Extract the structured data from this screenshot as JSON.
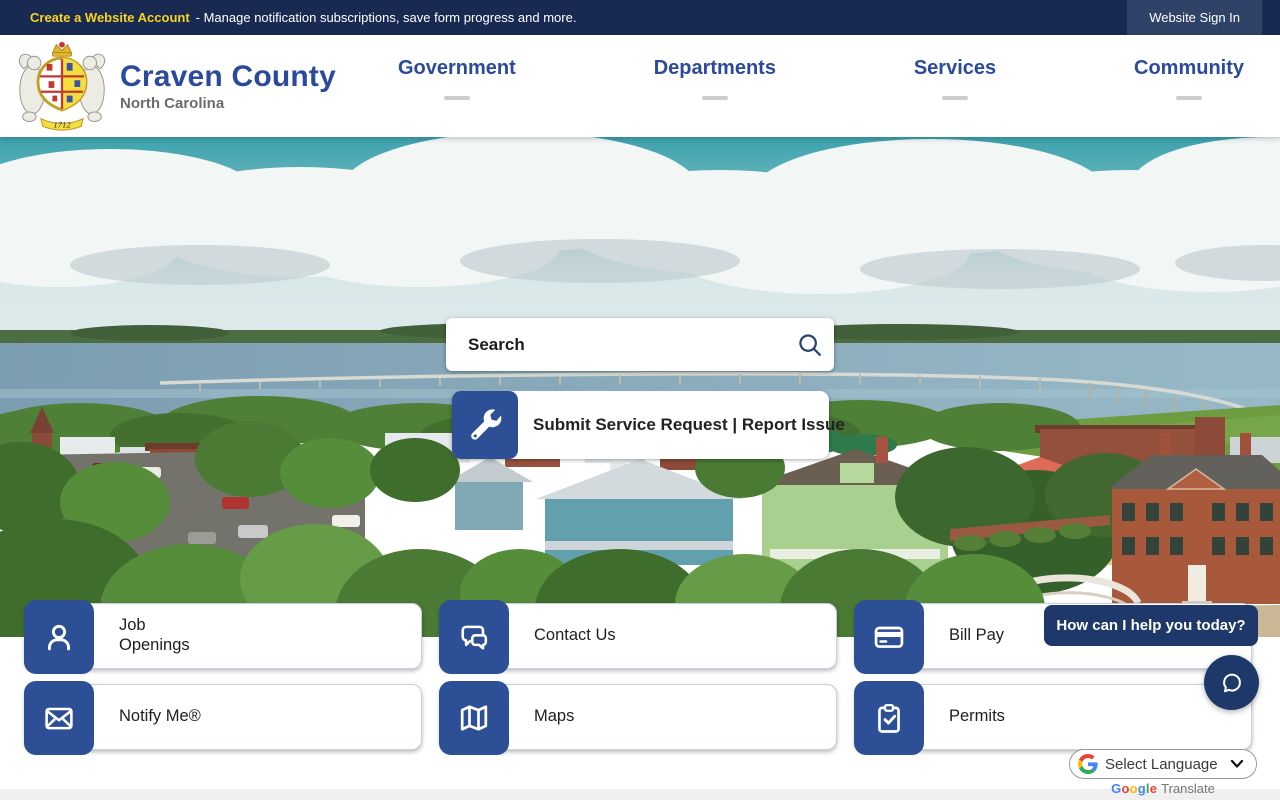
{
  "topbar": {
    "account_link": "Create a Website Account",
    "tagline": "- Manage notification subscriptions, save form progress and more.",
    "signin_label": "Website Sign In"
  },
  "header": {
    "title": "Craven County",
    "subtitle": "North Carolina",
    "seal_year": "1712",
    "nav": [
      {
        "label": "Government"
      },
      {
        "label": "Departments"
      },
      {
        "label": "Services"
      },
      {
        "label": "Community"
      }
    ]
  },
  "hero": {
    "search_placeholder": "Search",
    "service_button_label": "Submit Service Request | Report Issue"
  },
  "quicklinks": {
    "items": [
      {
        "label": "Job Openings",
        "icon": "person-icon"
      },
      {
        "label": "Contact Us",
        "icon": "chat-bubbles-icon"
      },
      {
        "label": "Bill Pay",
        "icon": "credit-card-icon"
      },
      {
        "label": "Notify Me®",
        "icon": "envelope-icon"
      },
      {
        "label": "Maps",
        "icon": "map-icon"
      },
      {
        "label": "Permits",
        "icon": "clipboard-check-icon"
      }
    ]
  },
  "chat": {
    "tooltip": "How can I help you today?"
  },
  "translate": {
    "label": "Select Language",
    "brand_google": "Google",
    "brand_translate": "Translate",
    "google_letter_colors": [
      "#4285F4",
      "#EA4335",
      "#FBBC05",
      "#4285F4",
      "#34A853",
      "#EA4335"
    ]
  },
  "colors": {
    "navy": "#1d3869",
    "topbar_navy": "#182a52",
    "brand_blue": "#2b4a9b",
    "icon_blue": "#2d4f96",
    "accent_yellow": "#f8d41c"
  }
}
